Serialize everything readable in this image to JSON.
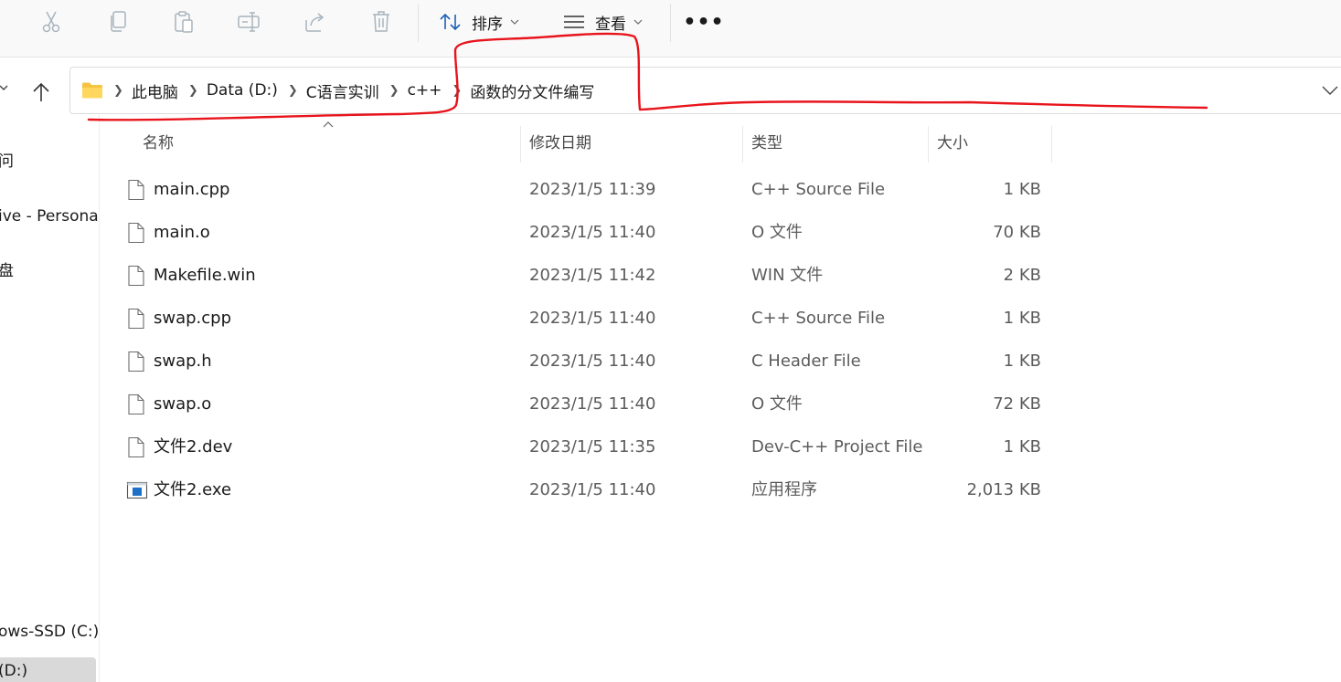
{
  "toolbar": {
    "icons": [
      "cut-icon",
      "copy-icon",
      "paste-icon",
      "rename-icon",
      "share-icon",
      "delete-icon"
    ],
    "sort_label": "排序",
    "view_label": "查看",
    "more_label": "•••"
  },
  "address": {
    "breadcrumbs": [
      "此电脑",
      "Data (D:)",
      "C语言实训",
      "c++",
      "函数的分文件编写"
    ]
  },
  "sidebar": {
    "items": [
      {
        "label": "问"
      },
      {
        "label": "ive - Persona"
      },
      {
        "label": "盘"
      },
      {
        "label": "ows-SSD (C:)"
      },
      {
        "label": "(D:)"
      }
    ]
  },
  "columns": {
    "name": "名称",
    "date": "修改日期",
    "type": "类型",
    "size": "大小"
  },
  "files": [
    {
      "name": "main.cpp",
      "date": "2023/1/5 11:39",
      "type": "C++ Source File",
      "size": "1 KB",
      "icon": "document-icon"
    },
    {
      "name": "main.o",
      "date": "2023/1/5 11:40",
      "type": "O 文件",
      "size": "70 KB",
      "icon": "document-icon"
    },
    {
      "name": "Makefile.win",
      "date": "2023/1/5 11:42",
      "type": "WIN 文件",
      "size": "2 KB",
      "icon": "document-icon"
    },
    {
      "name": "swap.cpp",
      "date": "2023/1/5 11:40",
      "type": "C++ Source File",
      "size": "1 KB",
      "icon": "document-icon"
    },
    {
      "name": "swap.h",
      "date": "2023/1/5 11:40",
      "type": "C Header File",
      "size": "1 KB",
      "icon": "document-icon"
    },
    {
      "name": "swap.o",
      "date": "2023/1/5 11:40",
      "type": "O 文件",
      "size": "72 KB",
      "icon": "document-icon"
    },
    {
      "name": "文件2.dev",
      "date": "2023/1/5 11:35",
      "type": "Dev-C++ Project File",
      "size": "1 KB",
      "icon": "document-icon"
    },
    {
      "name": "文件2.exe",
      "date": "2023/1/5 11:40",
      "type": "应用程序",
      "size": "2,013 KB",
      "icon": "application-icon"
    }
  ],
  "colors": {
    "annotation": "#e8141c",
    "folder": "#f6c343",
    "app_icon": "#1e6fc8"
  }
}
